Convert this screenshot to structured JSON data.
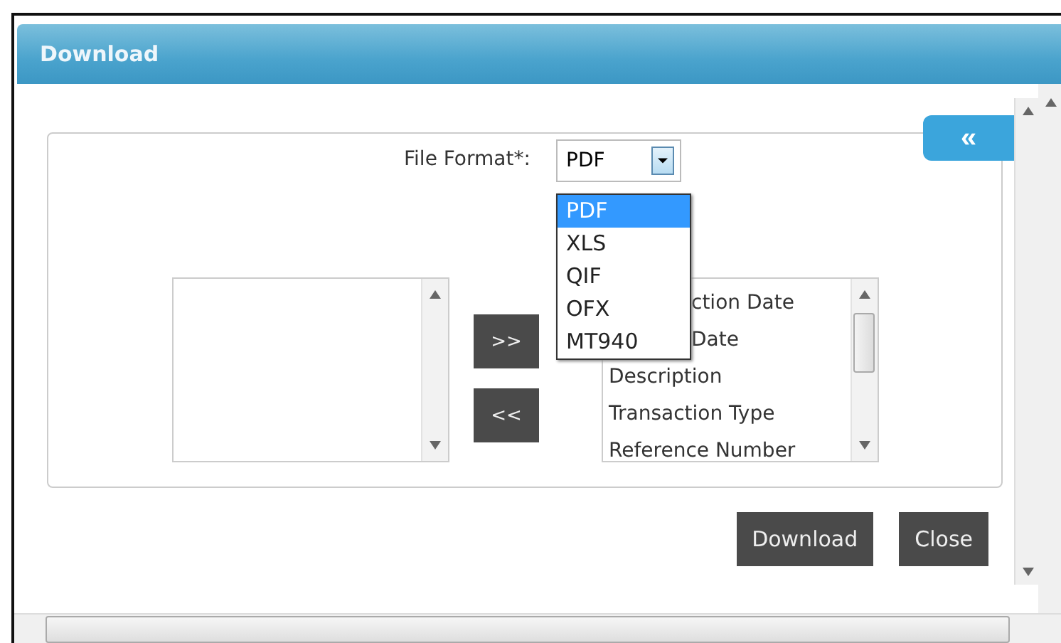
{
  "window": {
    "title": "Download"
  },
  "collapse_button": {
    "label": "«"
  },
  "file_format": {
    "label": "File Format*:",
    "value": "PDF",
    "expanded": true,
    "options": [
      {
        "label": "PDF",
        "selected": true
      },
      {
        "label": "XLS",
        "selected": false
      },
      {
        "label": "QIF",
        "selected": false
      },
      {
        "label": "OFX",
        "selected": false
      },
      {
        "label": "MT940",
        "selected": false
      }
    ]
  },
  "move_buttons": [
    ">>",
    "<<"
  ],
  "available_columns": [
    {
      "label": "ction Date",
      "kind": "clipped"
    },
    {
      "label": "Date",
      "kind": "clipped"
    },
    {
      "label": "Description",
      "kind": "full"
    },
    {
      "label": "Transaction Type",
      "kind": "full"
    },
    {
      "label": "Reference Number",
      "kind": "full"
    }
  ],
  "buttons": [
    "Download",
    "Close"
  ]
}
